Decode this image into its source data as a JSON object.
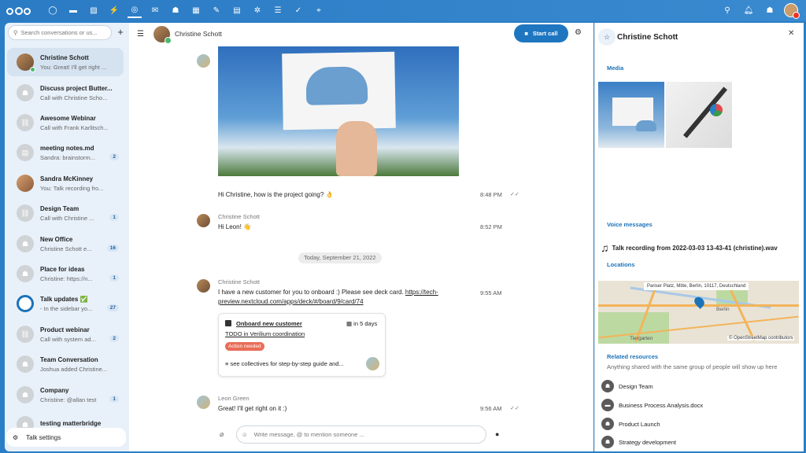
{
  "colors": {
    "accent": "#1f76c0",
    "topbar": "#2a7bc4",
    "badge_red": "#e96d57",
    "online": "#4ab870"
  },
  "topbar": {
    "apps": [
      "dashboard-icon",
      "files-icon",
      "photos-icon",
      "activity-icon",
      "talk-icon",
      "mail-icon",
      "contacts-icon",
      "calendar-icon",
      "notes-icon",
      "deck-icon",
      "tasks-icon",
      "checklist-icon",
      "done-icon",
      "maps-icon"
    ],
    "right": [
      "search-icon",
      "notifications-icon",
      "contacts-menu-icon"
    ]
  },
  "sidebar": {
    "search_placeholder": "Search conversations or us...",
    "conversations": [
      {
        "name": "Christine Schott",
        "sub": "You: Great! I'll get right ...",
        "badge": ""
      },
      {
        "name": "Discuss project Butter...",
        "sub": "Call with Christine Scho...",
        "badge": ""
      },
      {
        "name": "Awesome Webinar",
        "sub": "Call with Frank Karlitsch...",
        "badge": ""
      },
      {
        "name": "meeting notes.md",
        "sub": "Sandra: brainstorm...",
        "badge": "2"
      },
      {
        "name": "Sandra McKinney",
        "sub": "You: Talk recording fro...",
        "badge": ""
      },
      {
        "name": "Design Team",
        "sub": "Call with Christine ...",
        "badge": "1"
      },
      {
        "name": "New Office",
        "sub": "Christine Schott e...",
        "badge": "16"
      },
      {
        "name": "Place for ideas",
        "sub": "Christine: https://n...",
        "badge": "1"
      },
      {
        "name": "Talk updates ✅",
        "sub": "- In the sidebar yo...",
        "badge": "27"
      },
      {
        "name": "Product webinar",
        "sub": "Call with system ad...",
        "badge": "2"
      },
      {
        "name": "Team Conversation",
        "sub": "Joshua added Christine...",
        "badge": ""
      },
      {
        "name": "Company",
        "sub": "Christine: @allan test",
        "badge": "1"
      },
      {
        "name": "testing matterbridge",
        "sub": "",
        "badge": ""
      }
    ],
    "settings_label": "Talk settings"
  },
  "chat": {
    "title": "Christine Schott",
    "start_call": "Start call",
    "messages": [
      {
        "author": "",
        "text": "Hi Christine, how is the project going? 👌",
        "time": "8:48 PM"
      },
      {
        "author": "Christine Schott",
        "text": "Hi Leon! 👋",
        "time": "8:52 PM"
      },
      {
        "author": "Christine Schott",
        "text": "I have a new customer for you to onboard :) Please see deck card. ",
        "link1": "https://tech-",
        "link2": "preview.nextcloud.com/apps/deck/#/board/9/card/74",
        "time": "9:55 AM"
      },
      {
        "author": "Leon Green",
        "text": "Great! I'll get right on it :)",
        "time": "9:56 AM"
      }
    ],
    "day_separator": "Today, September 21, 2022",
    "card": {
      "title": "Onboard new customer",
      "due": "in 5 days",
      "list": "TODO in Verilium coordination",
      "tag": "Action needed",
      "desc": "see collectives for step-by-step guide and..."
    },
    "composer_placeholder": "Write message, @ to mention someone ..."
  },
  "right": {
    "title": "Christine Schott",
    "media_label": "Media",
    "voice_label": "Voice messages",
    "voice_file": "Talk recording from 2022-03-03 13-43-41 (christine).wav",
    "locations_label": "Locations",
    "map_address": "Pariser Platz, Mitte, Berlin, 10117, Deutschland",
    "map_city": "Berlin",
    "map_district": "Tiergarten",
    "map_copyright": "© OpenStreetMap contributors",
    "related_label": "Related resources",
    "related_desc": "Anything shared with the same group of people will show up here",
    "related": [
      "Design Team",
      "Business Process Analysis.docx",
      "Product Launch",
      "Strategy development"
    ]
  }
}
